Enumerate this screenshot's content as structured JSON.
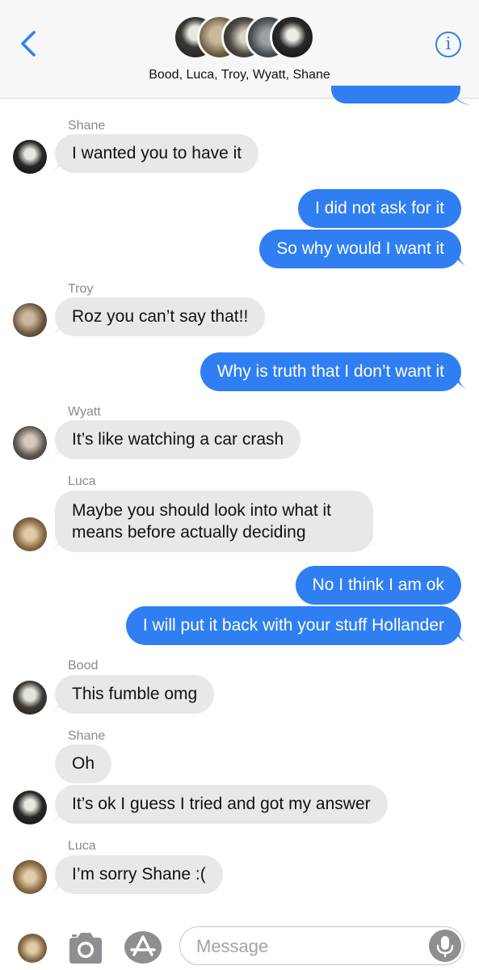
{
  "header": {
    "title": "Bood, Luca, Troy, Wyatt, Shane",
    "back_icon": "chevron-left-icon",
    "info_icon": "info-icon",
    "info_glyph": "i"
  },
  "messages": [
    {
      "from": "Shane",
      "sender_label": "Shane",
      "text": "I wanted you to have it"
    },
    {
      "from": "me",
      "text": "I did not ask for it"
    },
    {
      "from": "me",
      "text": "So why would I want it"
    },
    {
      "from": "Troy",
      "sender_label": "Troy",
      "text": "Roz you can’t say that!!"
    },
    {
      "from": "me",
      "text": "Why is truth that I don’t want it"
    },
    {
      "from": "Wyatt",
      "sender_label": "Wyatt",
      "text": "It’s like watching a car crash"
    },
    {
      "from": "Luca",
      "sender_label": "Luca",
      "text": "Maybe you should look into what it means before actually deciding"
    },
    {
      "from": "me",
      "text": "No I think I am ok"
    },
    {
      "from": "me",
      "text": "I will put it back with your stuff Hollander"
    },
    {
      "from": "Bood",
      "sender_label": "Bood",
      "text": "This fumble omg"
    },
    {
      "from": "Shane",
      "sender_label": "Shane",
      "text": "Oh"
    },
    {
      "from": "Shane",
      "text": "It’s ok I guess I tried and got my answer"
    },
    {
      "from": "Luca",
      "sender_label": "Luca",
      "text": "I’m sorry Shane :("
    }
  ],
  "input_bar": {
    "placeholder": "Message",
    "camera_icon": "camera-icon",
    "apps_icon": "app-store-icon",
    "mic_icon": "microphone-icon"
  },
  "colors": {
    "outgoing_bubble": "#2f7ff3",
    "incoming_bubble": "#e8e8ea",
    "accent": "#2f80ed"
  }
}
